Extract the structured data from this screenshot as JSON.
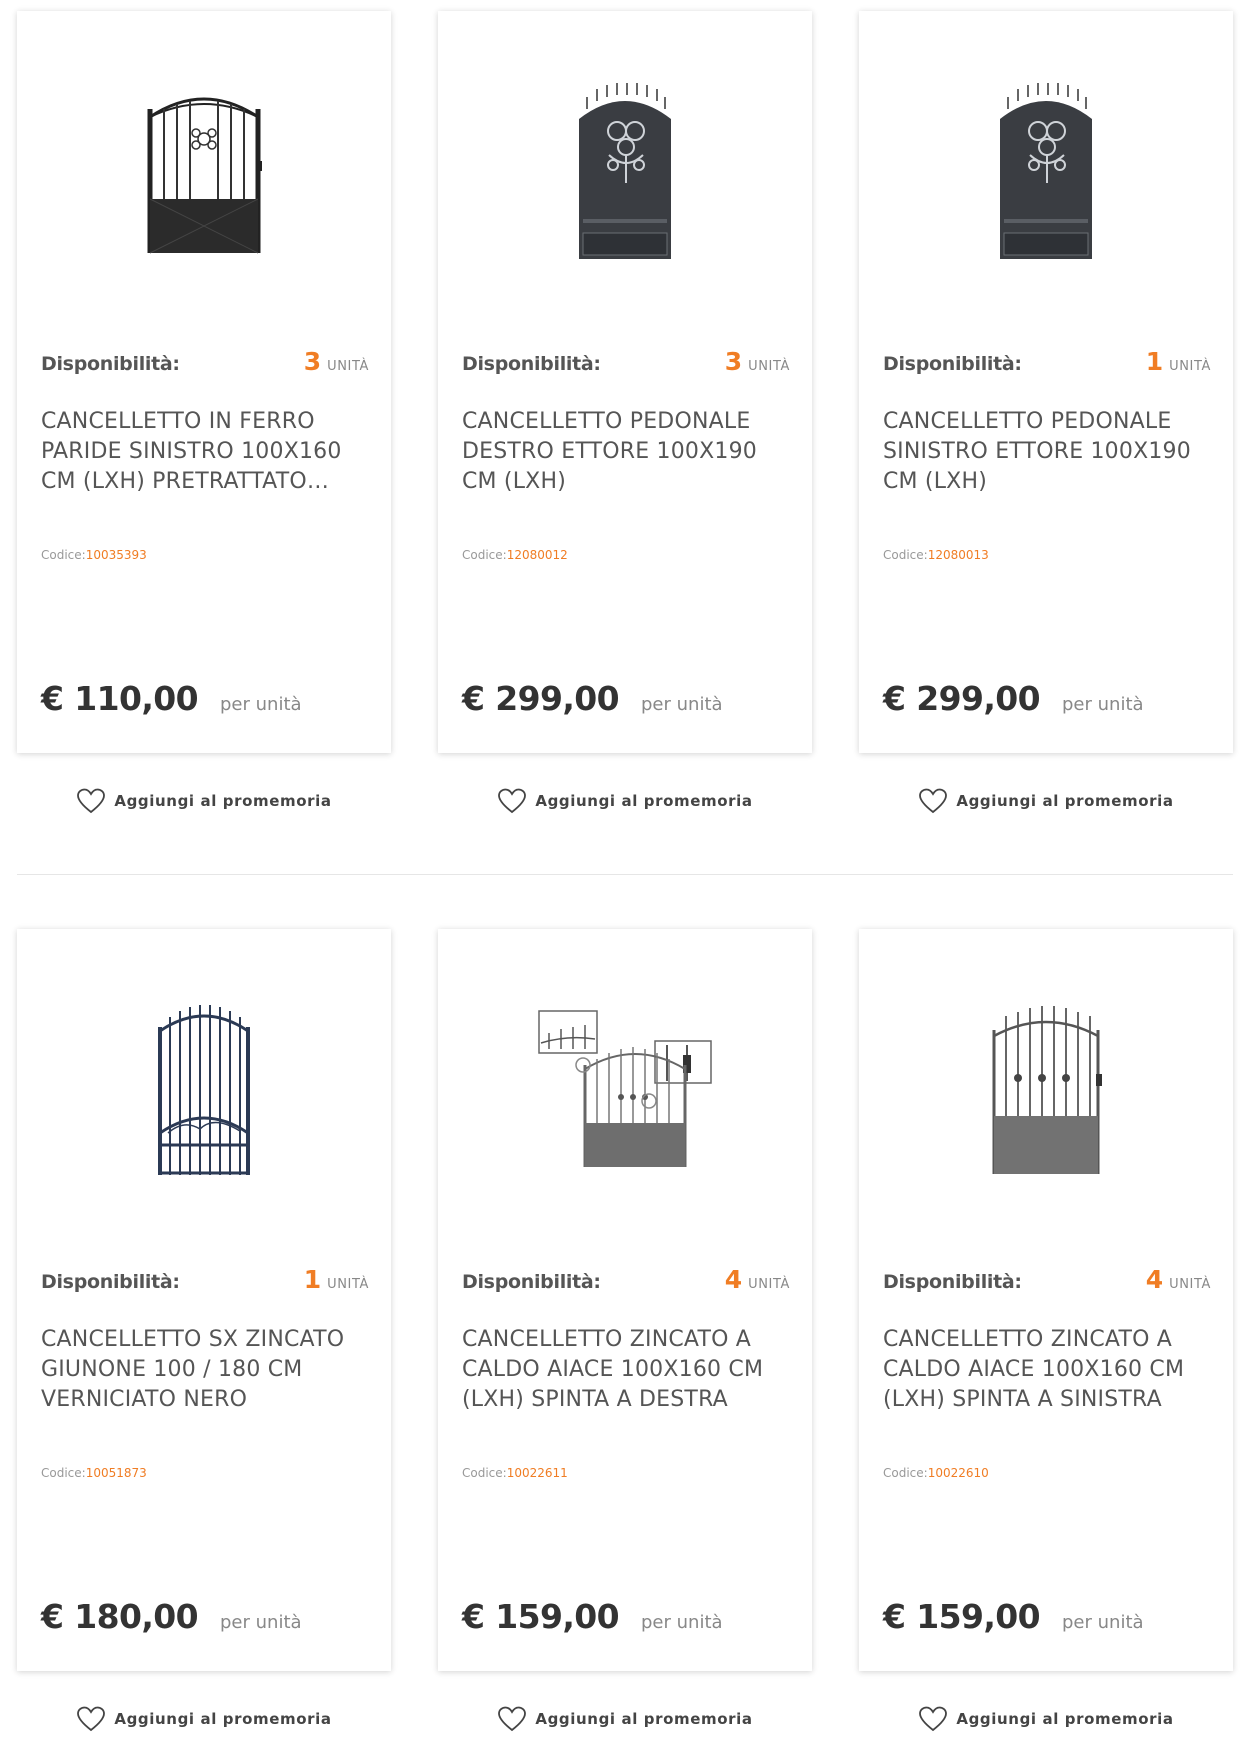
{
  "labels": {
    "availability": "Disponibilità:",
    "unit": "UNITÀ",
    "code_prefix": "Codice:",
    "per_unit": "per unità",
    "wishlist": "Aggiungi al promemoria"
  },
  "colors": {
    "accent": "#f07d24",
    "text": "#555555"
  },
  "products": [
    {
      "image": "gate-paride-icon",
      "qty": "3",
      "title": "CANCELLETTO IN FERRO PARIDE SINISTRO 100X160 CM (LXH) PRETRATTATO…",
      "code": "10035393",
      "price": "€ 110,00"
    },
    {
      "image": "gate-ettore-dx-icon",
      "qty": "3",
      "title": "CANCELLETTO PEDONALE DESTRO ETTORE 100X190 CM (LXH)",
      "code": "12080012",
      "price": "€ 299,00"
    },
    {
      "image": "gate-ettore-sx-icon",
      "qty": "1",
      "title": "CANCELLETTO PEDONALE SINISTRO ETTORE 100X190 CM (LXH)",
      "code": "12080013",
      "price": "€ 299,00"
    },
    {
      "image": "gate-giunone-icon",
      "qty": "1",
      "title": "CANCELLETTO SX ZINCATO GIUNONE 100 / 180 CM VERNICIATO NERO",
      "code": "10051873",
      "price": "€ 180,00"
    },
    {
      "image": "gate-aiace-dx-icon",
      "qty": "4",
      "title": "CANCELLETTO ZINCATO A CALDO AIACE 100X160 CM (LXH) SPINTA A DESTRA",
      "code": "10022611",
      "price": "€ 159,00"
    },
    {
      "image": "gate-aiace-sx-icon",
      "qty": "4",
      "title": "CANCELLETTO ZINCATO A CALDO AIACE 100X160 CM (LXH) SPINTA A SINISTRA",
      "code": "10022610",
      "price": "€ 159,00"
    }
  ]
}
